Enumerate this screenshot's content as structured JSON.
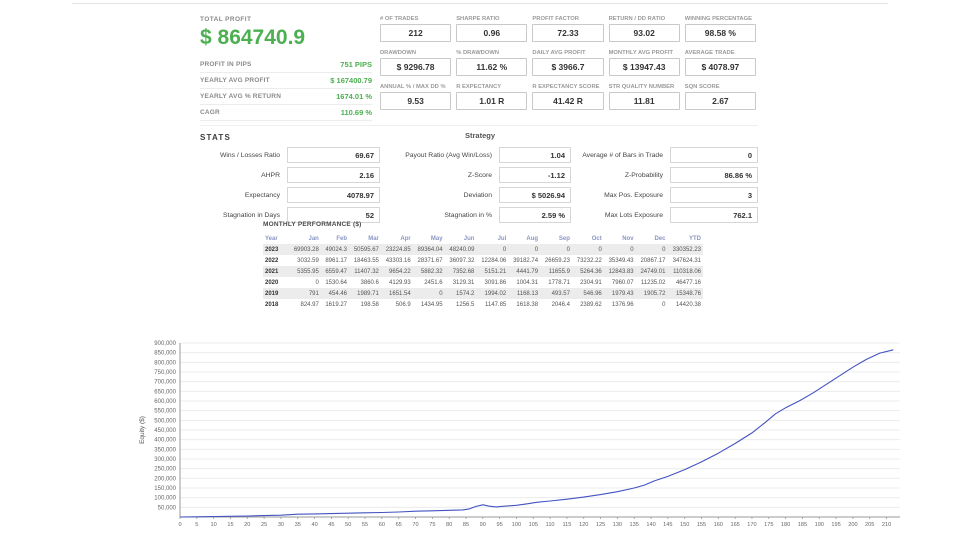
{
  "colors": {
    "accent_green": "#4caf50",
    "equity_line": "#4353c1",
    "stripe_gray": "#ececec"
  },
  "summary": {
    "total_profit_label": "TOTAL PROFIT",
    "total_profit_value": "$ 864740.9",
    "rows": [
      {
        "label": "PROFIT IN PIPS",
        "value": "751 PIPS"
      },
      {
        "label": "YEARLY AVG PROFIT",
        "value": "$ 167400.79"
      },
      {
        "label": "YEARLY AVG % RETURN",
        "value": "1674.01 %"
      },
      {
        "label": "CAGR",
        "value": "110.69 %"
      }
    ],
    "stats_label": "STATS"
  },
  "metrics": [
    [
      {
        "label": "# OF TRADES",
        "value": "212"
      },
      {
        "label": "SHARPE RATIO",
        "value": "0.96"
      },
      {
        "label": "PROFIT FACTOR",
        "value": "72.33"
      },
      {
        "label": "RETURN / DD RATIO",
        "value": "93.02"
      },
      {
        "label": "WINNING PERCENTAGE",
        "value": "98.58 %"
      }
    ],
    [
      {
        "label": "DRAWDOWN",
        "value": "$ 9296.78"
      },
      {
        "label": "% DRAWDOWN",
        "value": "11.62 %"
      },
      {
        "label": "DAILY AVG PROFIT",
        "value": "$ 3966.7"
      },
      {
        "label": "MONTHLY AVG PROFIT",
        "value": "$ 13947.43"
      },
      {
        "label": "AVERAGE TRADE",
        "value": "$ 4078.97"
      }
    ],
    [
      {
        "label": "ANNUAL % / MAX DD %",
        "value": "9.53"
      },
      {
        "label": "R EXPECTANCY",
        "value": "1.01 R"
      },
      {
        "label": "R EXPECTANCY SCORE",
        "value": "41.42 R"
      },
      {
        "label": "STR QUALITY NUMBER",
        "value": "11.81"
      },
      {
        "label": "SQN SCORE",
        "value": "2.67"
      }
    ]
  ],
  "strategy_table": {
    "title": "Strategy",
    "rows": [
      [
        {
          "label": "Wins / Losses Ratio",
          "value": "69.67"
        },
        {
          "label": "Payout Ratio (Avg Win/Loss)",
          "value": "1.04"
        },
        {
          "label": "Average # of Bars in Trade",
          "value": "0"
        }
      ],
      [
        {
          "label": "AHPR",
          "value": "2.16"
        },
        {
          "label": "Z-Score",
          "value": "-1.12"
        },
        {
          "label": "Z-Probability",
          "value": "86.86 %"
        }
      ],
      [
        {
          "label": "Expectancy",
          "value": "4078.97"
        },
        {
          "label": "Deviation",
          "value": "$ 5026.94"
        },
        {
          "label": "Max Pos. Exposure",
          "value": "3"
        }
      ],
      [
        {
          "label": "Stagnation in Days",
          "value": "52"
        },
        {
          "label": "Stagnation in %",
          "value": "2.59 %"
        },
        {
          "label": "Max Lots Exposure",
          "value": "762.1"
        }
      ]
    ]
  },
  "monthly": {
    "title": "MONTHLY PERFORMANCE ($)",
    "columns": [
      "Year",
      "Jan",
      "Feb",
      "Mar",
      "Apr",
      "May",
      "Jun",
      "Jul",
      "Aug",
      "Sep",
      "Oct",
      "Nov",
      "Dec",
      "YTD"
    ],
    "rows": [
      {
        "year": "2023",
        "values": [
          "69903.28",
          "49024.3",
          "50595.67",
          "23224.85",
          "89364.04",
          "48240.09",
          "0",
          "0",
          "0",
          "0",
          "0",
          "0",
          "330352.23"
        ]
      },
      {
        "year": "2022",
        "values": [
          "3032.59",
          "8961.17",
          "18463.55",
          "43303.16",
          "28371.67",
          "36097.32",
          "12284.06",
          "39182.74",
          "26659.23",
          "73232.22",
          "35349.43",
          "20867.17",
          "347624.31"
        ]
      },
      {
        "year": "2021",
        "values": [
          "5355.95",
          "6559.47",
          "11407.32",
          "9654.22",
          "5882.32",
          "7352.68",
          "5151.21",
          "4441.79",
          "11655.9",
          "5264.36",
          "12843.83",
          "24749.01",
          "110318.06"
        ]
      },
      {
        "year": "2020",
        "values": [
          "0",
          "1530.64",
          "3860.6",
          "4129.93",
          "2451.6",
          "3129.31",
          "3091.86",
          "1004.31",
          "1778.71",
          "2304.91",
          "7960.07",
          "11235.02",
          "46477.16"
        ]
      },
      {
        "year": "2019",
        "values": [
          "791",
          "454.46",
          "1989.71",
          "1651.54",
          "0",
          "1574.2",
          "1994.02",
          "1168.13",
          "493.57",
          "546.96",
          "1979.43",
          "1905.72",
          "15348.76"
        ]
      },
      {
        "year": "2018",
        "values": [
          "824.97",
          "1619.27",
          "198.58",
          "506.9",
          "1434.95",
          "1256.5",
          "1147.85",
          "1618.38",
          "2046.4",
          "2389.62",
          "1376.96",
          "0",
          "14420.38"
        ]
      }
    ]
  },
  "chart_data": {
    "type": "line",
    "title": "",
    "xlabel": "",
    "ylabel": "Equity ($)",
    "series_name": "Equity",
    "xlim": [
      0,
      214
    ],
    "ylim": [
      0,
      900000
    ],
    "xtick_step": 5,
    "ytick_step": 50000,
    "grid": "horizontal",
    "line_color": "#4353c1",
    "points": [
      [
        0,
        0
      ],
      [
        5,
        1200
      ],
      [
        10,
        2500
      ],
      [
        15,
        3800
      ],
      [
        20,
        5200
      ],
      [
        25,
        7000
      ],
      [
        30,
        9500
      ],
      [
        35,
        14400
      ],
      [
        40,
        16000
      ],
      [
        45,
        17800
      ],
      [
        50,
        19500
      ],
      [
        55,
        21500
      ],
      [
        60,
        23500
      ],
      [
        65,
        26000
      ],
      [
        70,
        29800
      ],
      [
        75,
        32000
      ],
      [
        80,
        34500
      ],
      [
        84,
        36500
      ],
      [
        86,
        42000
      ],
      [
        88,
        55000
      ],
      [
        90,
        63000
      ],
      [
        92,
        56000
      ],
      [
        94,
        52000
      ],
      [
        96,
        55500
      ],
      [
        100,
        60500
      ],
      [
        103,
        68000
      ],
      [
        106,
        76200
      ],
      [
        110,
        83000
      ],
      [
        115,
        92000
      ],
      [
        120,
        103000
      ],
      [
        125,
        116000
      ],
      [
        130,
        131000
      ],
      [
        135,
        150000
      ],
      [
        138,
        165000
      ],
      [
        141,
        186500
      ],
      [
        145,
        210000
      ],
      [
        150,
        245000
      ],
      [
        155,
        285000
      ],
      [
        160,
        330000
      ],
      [
        165,
        380000
      ],
      [
        170,
        435000
      ],
      [
        174,
        490000
      ],
      [
        177,
        534000
      ],
      [
        180,
        565000
      ],
      [
        184,
        600000
      ],
      [
        188,
        640000
      ],
      [
        192,
        685000
      ],
      [
        196,
        730000
      ],
      [
        200,
        775000
      ],
      [
        204,
        815000
      ],
      [
        208,
        848000
      ],
      [
        211,
        860000
      ],
      [
        212,
        864741
      ]
    ]
  }
}
